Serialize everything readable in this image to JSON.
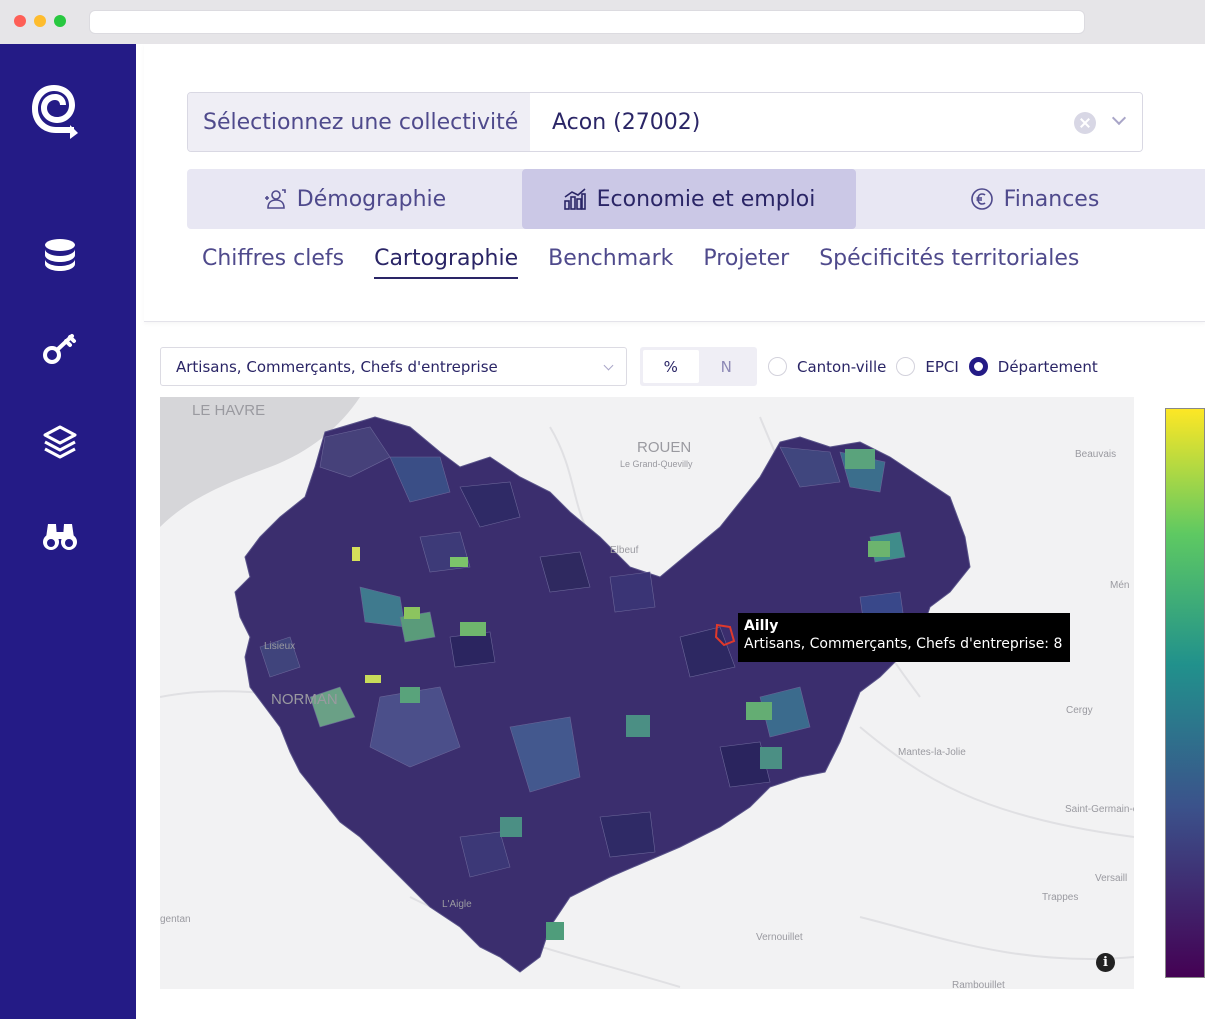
{
  "selector": {
    "label": "Sélectionnez une collectivité",
    "value": "Acon (27002)"
  },
  "tabs": [
    {
      "label": "Démographie",
      "icon": "people-icon",
      "active": false
    },
    {
      "label": "Economie et emploi",
      "icon": "bar-chart-icon",
      "active": true
    },
    {
      "label": "Finances",
      "icon": "euro-icon",
      "active": false
    }
  ],
  "subtabs": [
    {
      "label": "Chiffres clefs",
      "active": false
    },
    {
      "label": "Cartographie",
      "active": true
    },
    {
      "label": "Benchmark",
      "active": false
    },
    {
      "label": "Projeter",
      "active": false
    },
    {
      "label": "Spécificités territoriales",
      "active": false
    }
  ],
  "controls": {
    "indicator": "Artisans, Commerçants, Chefs d'entreprise",
    "mode_options": [
      "%",
      "N"
    ],
    "mode_selected": "%",
    "scale_options": [
      "Canton-ville",
      "EPCI",
      "Département"
    ],
    "scale_selected": "Département"
  },
  "map": {
    "place_labels": [
      "LE HAVRE",
      "ROUEN",
      "Le Grand-Quevilly",
      "Elbeuf",
      "Beauvais",
      "Lisieux",
      "NORMAN",
      "Cergy",
      "Mantes-la-Jolie",
      "Saint-Germain-en-Laye",
      "Versaill",
      "Trappes",
      "L'Aigle",
      "Vernouillet",
      "gentan",
      "Rambouillet",
      "Mén"
    ],
    "tooltip": {
      "title": "Ailly",
      "body": "Artisans, Commerçants, Chefs d'entreprise: 8"
    },
    "colorscale": [
      "#440154",
      "#3b528b",
      "#21918c",
      "#5ec962",
      "#fde725"
    ]
  },
  "sidebar": {
    "items": [
      "logo-icon",
      "database-icon",
      "key-icon",
      "layers-icon",
      "binoculars-icon"
    ]
  }
}
